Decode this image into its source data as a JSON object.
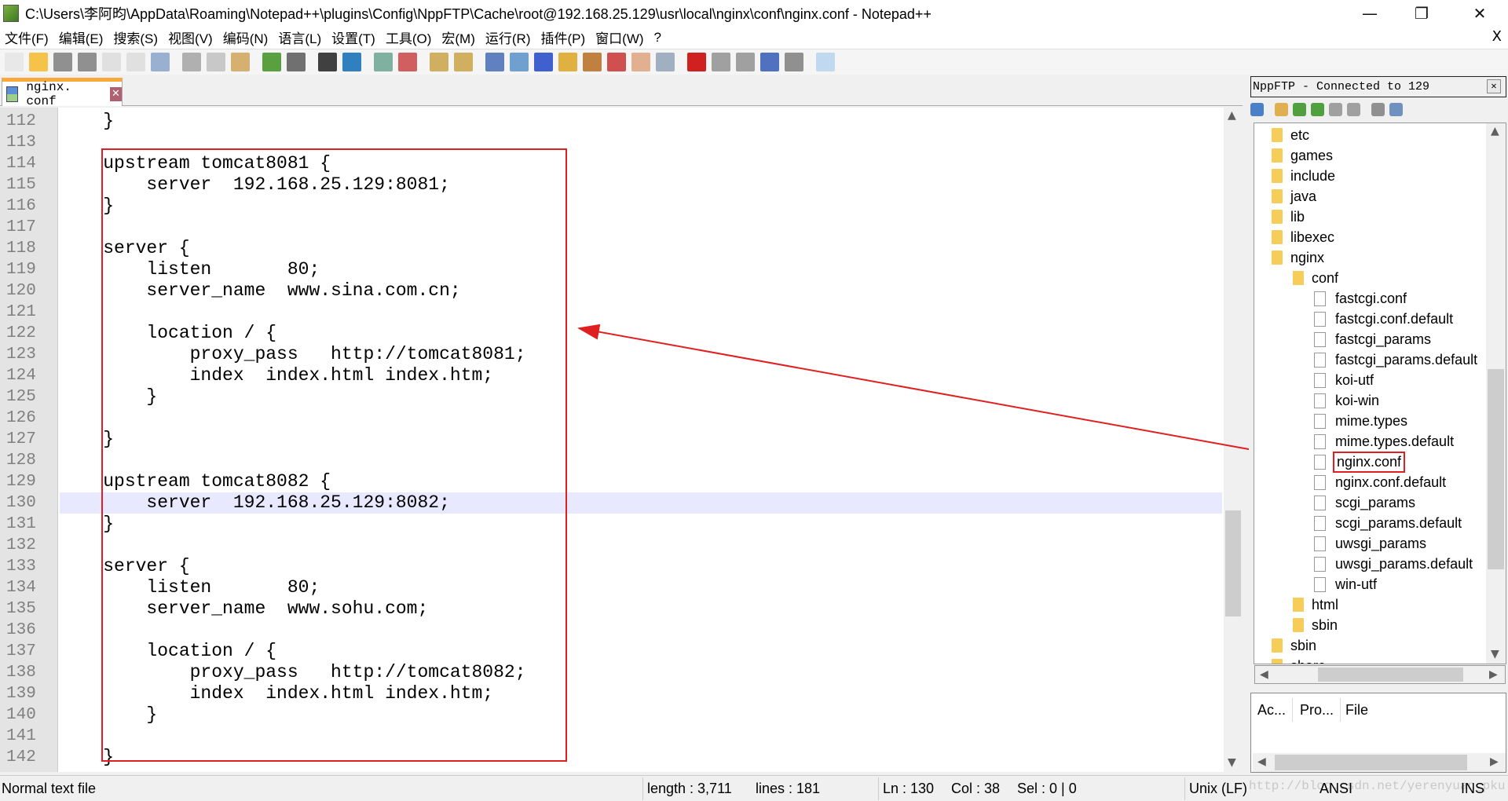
{
  "window": {
    "title": "C:\\Users\\李阿昀\\AppData\\Roaming\\Notepad++\\plugins\\Config\\NppFTP\\Cache\\root@192.168.25.129\\usr\\local\\nginx\\conf\\nginx.conf - Notepad++",
    "minimize": "—",
    "restore": "❐",
    "close": "✕"
  },
  "menu": {
    "items": [
      "文件(F)",
      "编辑(E)",
      "搜索(S)",
      "视图(V)",
      "编码(N)",
      "语言(L)",
      "设置(T)",
      "工具(O)",
      "宏(M)",
      "运行(R)",
      "插件(P)",
      "窗口(W)",
      "?"
    ],
    "close": "X"
  },
  "toolbar": {
    "icons": [
      {
        "name": "new-file-icon",
        "color": "#e8e8e8"
      },
      {
        "name": "open-file-icon",
        "color": "#f5c24a"
      },
      {
        "name": "save-icon",
        "color": "#909090"
      },
      {
        "name": "save-all-icon",
        "color": "#909090"
      },
      {
        "name": "close-icon",
        "color": "#e0e0e0"
      },
      {
        "name": "close-all-icon",
        "color": "#e0e0e0"
      },
      {
        "name": "print-icon",
        "color": "#9ab0d0"
      },
      {
        "name": "cut-icon",
        "color": "#b0b0b0"
      },
      {
        "name": "copy-icon",
        "color": "#c8c8c8"
      },
      {
        "name": "paste-icon",
        "color": "#d6b070"
      },
      {
        "name": "undo-icon",
        "color": "#5aa040"
      },
      {
        "name": "redo-icon",
        "color": "#707070"
      },
      {
        "name": "find-icon",
        "color": "#404040"
      },
      {
        "name": "replace-icon",
        "color": "#3080c0"
      },
      {
        "name": "zoom-in-icon",
        "color": "#80b0a0"
      },
      {
        "name": "zoom-out-icon",
        "color": "#d06060"
      },
      {
        "name": "sync-vertical-icon",
        "color": "#d0b060"
      },
      {
        "name": "sync-horizontal-icon",
        "color": "#d0b060"
      },
      {
        "name": "word-wrap-icon",
        "color": "#6080c0"
      },
      {
        "name": "show-all-chars-icon",
        "color": "#70a0d0"
      },
      {
        "name": "indent-guide-icon",
        "color": "#4060d0"
      },
      {
        "name": "user-language-icon",
        "color": "#e0b040"
      },
      {
        "name": "document-map-icon",
        "color": "#c08040"
      },
      {
        "name": "function-list-icon",
        "color": "#d05050"
      },
      {
        "name": "folder-workspace-icon",
        "color": "#e0b090"
      },
      {
        "name": "monitoring-icon",
        "color": "#a0b0c0"
      },
      {
        "name": "record-macro-icon",
        "color": "#d02020"
      },
      {
        "name": "stop-record-icon",
        "color": "#a0a0a0"
      },
      {
        "name": "play-macro-icon",
        "color": "#a0a0a0"
      },
      {
        "name": "run-macro-multiple-icon",
        "color": "#5070c0"
      },
      {
        "name": "save-macro-icon",
        "color": "#909090"
      },
      {
        "name": "nppftp-icon",
        "color": "#c0d8f0"
      }
    ]
  },
  "tab": {
    "label": "nginx. conf",
    "close": "✕"
  },
  "editor": {
    "current_line": 130,
    "lines": [
      {
        "n": "112",
        "t": "    }"
      },
      {
        "n": "113",
        "t": ""
      },
      {
        "n": "114",
        "t": "    upstream tomcat8081 {"
      },
      {
        "n": "115",
        "t": "        server  192.168.25.129:8081;"
      },
      {
        "n": "116",
        "t": "    }"
      },
      {
        "n": "117",
        "t": ""
      },
      {
        "n": "118",
        "t": "    server {"
      },
      {
        "n": "119",
        "t": "        listen       80;"
      },
      {
        "n": "120",
        "t": "        server_name  www.sina.com.cn;"
      },
      {
        "n": "121",
        "t": ""
      },
      {
        "n": "122",
        "t": "        location / {"
      },
      {
        "n": "123",
        "t": "            proxy_pass   http://tomcat8081;"
      },
      {
        "n": "124",
        "t": "            index  index.html index.htm;"
      },
      {
        "n": "125",
        "t": "        }"
      },
      {
        "n": "126",
        "t": ""
      },
      {
        "n": "127",
        "t": "    }"
      },
      {
        "n": "128",
        "t": ""
      },
      {
        "n": "129",
        "t": "    upstream tomcat8082 {"
      },
      {
        "n": "130",
        "t": "        server  192.168.25.129:8082;"
      },
      {
        "n": "131",
        "t": "    }"
      },
      {
        "n": "132",
        "t": ""
      },
      {
        "n": "133",
        "t": "    server {"
      },
      {
        "n": "134",
        "t": "        listen       80;"
      },
      {
        "n": "135",
        "t": "        server_name  www.sohu.com;"
      },
      {
        "n": "136",
        "t": ""
      },
      {
        "n": "137",
        "t": "        location / {"
      },
      {
        "n": "138",
        "t": "            proxy_pass   http://tomcat8082;"
      },
      {
        "n": "139",
        "t": "            index  index.html index.htm;"
      },
      {
        "n": "140",
        "t": "        }"
      },
      {
        "n": "141",
        "t": ""
      },
      {
        "n": "142",
        "t": "    }"
      }
    ]
  },
  "annotation": {
    "color": "#e02020"
  },
  "nppftp": {
    "title": "NppFTP - Connected to 129",
    "close": "✕",
    "tools": [
      {
        "name": "connect-icon",
        "color": "#4a80c8"
      },
      {
        "name": "open-directory-icon",
        "color": "#e0b050"
      },
      {
        "name": "download-icon",
        "color": "#50a040"
      },
      {
        "name": "upload-icon",
        "color": "#50a040"
      },
      {
        "name": "refresh-icon",
        "color": "#a0a0a0"
      },
      {
        "name": "abort-icon",
        "color": "#a0a0a0"
      },
      {
        "name": "settings-icon",
        "color": "#909090"
      },
      {
        "name": "message-window-icon",
        "color": "#7090c0"
      }
    ],
    "tree": [
      {
        "label": "etc",
        "type": "folder",
        "level": 0
      },
      {
        "label": "games",
        "type": "folder",
        "level": 0
      },
      {
        "label": "include",
        "type": "folder",
        "level": 0
      },
      {
        "label": "java",
        "type": "folder",
        "level": 0
      },
      {
        "label": "lib",
        "type": "folder",
        "level": 0
      },
      {
        "label": "libexec",
        "type": "folder",
        "level": 0
      },
      {
        "label": "nginx",
        "type": "folder",
        "level": 0
      },
      {
        "label": "conf",
        "type": "folder",
        "level": 1
      },
      {
        "label": "fastcgi.conf",
        "type": "file",
        "level": 2
      },
      {
        "label": "fastcgi.conf.default",
        "type": "file",
        "level": 2
      },
      {
        "label": "fastcgi_params",
        "type": "file",
        "level": 2
      },
      {
        "label": "fastcgi_params.default",
        "type": "file",
        "level": 2
      },
      {
        "label": "koi-utf",
        "type": "file",
        "level": 2
      },
      {
        "label": "koi-win",
        "type": "file",
        "level": 2
      },
      {
        "label": "mime.types",
        "type": "file",
        "level": 2
      },
      {
        "label": "mime.types.default",
        "type": "file",
        "level": 2
      },
      {
        "label": "nginx.conf",
        "type": "file",
        "level": 2,
        "selected": true
      },
      {
        "label": "nginx.conf.default",
        "type": "file",
        "level": 2
      },
      {
        "label": "scgi_params",
        "type": "file",
        "level": 2
      },
      {
        "label": "scgi_params.default",
        "type": "file",
        "level": 2
      },
      {
        "label": "uwsgi_params",
        "type": "file",
        "level": 2
      },
      {
        "label": "uwsgi_params.default",
        "type": "file",
        "level": 2
      },
      {
        "label": "win-utf",
        "type": "file",
        "level": 2
      },
      {
        "label": "html",
        "type": "folder",
        "level": 1
      },
      {
        "label": "sbin",
        "type": "folder",
        "level": 1
      },
      {
        "label": "sbin",
        "type": "folder",
        "level": 0
      },
      {
        "label": "share",
        "type": "folder",
        "level": 0
      }
    ],
    "queue_headers": [
      "Ac...",
      "Pro...",
      "File"
    ]
  },
  "status": {
    "file_type": "Normal text file",
    "length": "length : 3,711",
    "lines": "lines : 181",
    "ln": "Ln : 130",
    "col": "Col : 38",
    "sel": "Sel : 0 | 0",
    "eol": "Unix (LF)",
    "encoding": "ANSI",
    "mode": "INS",
    "watermark": "http://blog.csdn.net/yerenyuan_pku"
  }
}
